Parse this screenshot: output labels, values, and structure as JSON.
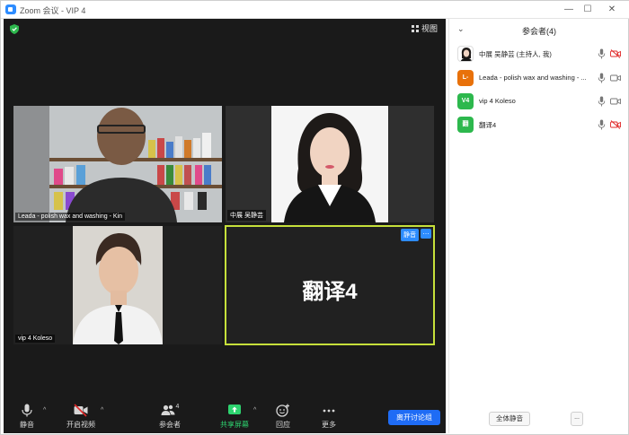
{
  "window": {
    "title": "Zoom 会议 - VIP 4",
    "controls": [
      "minimize-icon",
      "maximize-icon",
      "close-icon"
    ]
  },
  "meeting": {
    "view_label": "视图",
    "tiles": [
      {
        "name": "Leada - polish wax and washing - Kin"
      },
      {
        "name": "中展 吴静芸"
      },
      {
        "name": "vip 4 Koleso"
      },
      {
        "name": "翻译4",
        "display_name": "翻译4",
        "mute_label": "静音",
        "more_label": "…",
        "active_speaker": true
      }
    ]
  },
  "toolbar": {
    "mute": "静音",
    "start_video": "开启视频",
    "participants": "参会者",
    "participants_count": "4",
    "share": "共享屏幕",
    "reactions": "回应",
    "more": "更多",
    "leave": "离开讨论组"
  },
  "panel": {
    "title": "参会者(4)",
    "participants": [
      {
        "name": "中展 吴静芸 (主持人, 我)",
        "avatar": "photo",
        "avatar_color": "#ffffff",
        "mic": "on",
        "video": "off"
      },
      {
        "name": "Leada - polish wax and washing - ...",
        "avatar": "L-",
        "avatar_color": "#e8710a",
        "mic": "on",
        "video": "on"
      },
      {
        "name": "vip 4 Koleso",
        "avatar": "V4",
        "avatar_color": "#2db84d",
        "mic": "on",
        "video": "on"
      },
      {
        "name": "翻译4",
        "avatar": "翻",
        "avatar_color": "#2db84d",
        "mic": "on",
        "video": "off"
      }
    ],
    "mute_all": "全体静音",
    "more": "..."
  },
  "colors": {
    "accent_blue": "#2d8cff",
    "leave_blue": "#1f6cf5",
    "active_border": "#c6e03a",
    "share_green": "#2dd36f",
    "video_off_red": "#e02828"
  }
}
